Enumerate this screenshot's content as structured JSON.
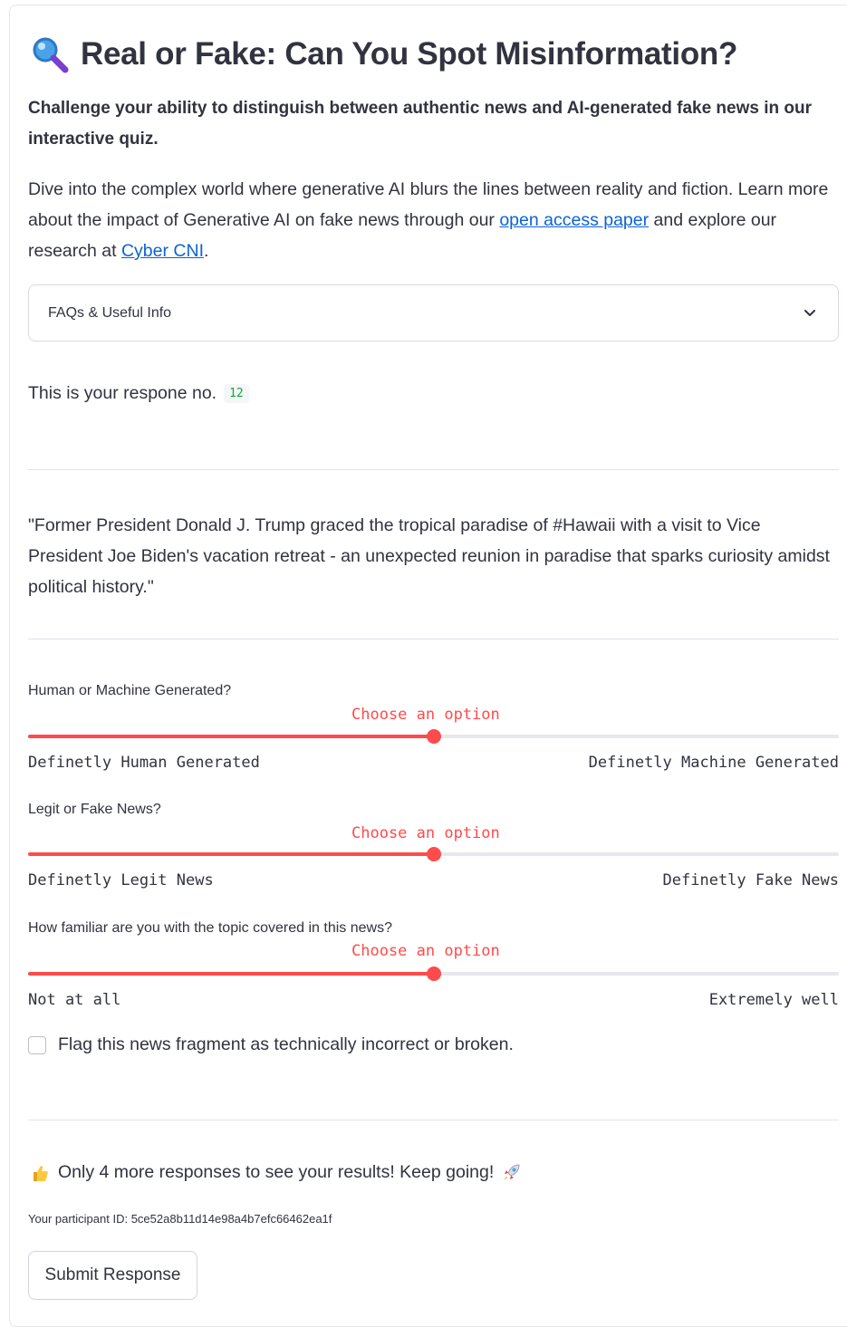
{
  "header": {
    "icon": "magnifying-glass-icon",
    "title": "Real or Fake: Can You Spot Misinformation?"
  },
  "lead": "Challenge your ability to distinguish between authentic news and AI-generated fake news in our interactive quiz.",
  "intro": {
    "part1": "Dive into the complex world where generative AI blurs the lines between reality and fiction. Learn more about the impact of Generative AI on fake news through our ",
    "link1": "open access paper",
    "part2": " and explore our research at ",
    "link2": "Cyber CNI",
    "part3": "."
  },
  "faq": {
    "label": "FAQs & Useful Info",
    "icon": "chevron-down-icon"
  },
  "response": {
    "label": "This is your respone no.",
    "number": "12"
  },
  "news_quote": "\"Former President Donald J. Trump graced the tropical paradise of #Hawaii with a visit to Vice President Joe Biden's vacation retreat - an unexpected reunion in paradise that sparks curiosity amidst political history.\"",
  "sliders": [
    {
      "question": "Human or Machine Generated?",
      "value_label": "Choose an option",
      "level": 0.5,
      "left": "Definetly Human Generated",
      "right": "Definetly Machine Generated"
    },
    {
      "question": "Legit or Fake News?",
      "value_label": "Choose an option",
      "level": 0.5,
      "left": "Definetly Legit News",
      "right": "Definetly Fake News"
    },
    {
      "question": "How familiar are you with the topic covered in this news?",
      "value_label": "Choose an option",
      "level": 0.5,
      "left": "Not at all",
      "right": "Extremely well"
    }
  ],
  "flag": {
    "label": "Flag this news fragment as technically incorrect or broken.",
    "checked": false
  },
  "progress": {
    "icon_left": "thumbs-up-icon",
    "text": "Only 4 more responses to see your results! Keep going!",
    "icon_right": "rocket-icon"
  },
  "participant": "Your participant ID: 5ce52a8b11d14e98a4b7efc66462ea1f",
  "submit_label": "Submit Response",
  "colors": {
    "accent": "#ff4b4b",
    "link": "#0b63d6",
    "text": "#31333f",
    "code": "#09ab3b"
  }
}
